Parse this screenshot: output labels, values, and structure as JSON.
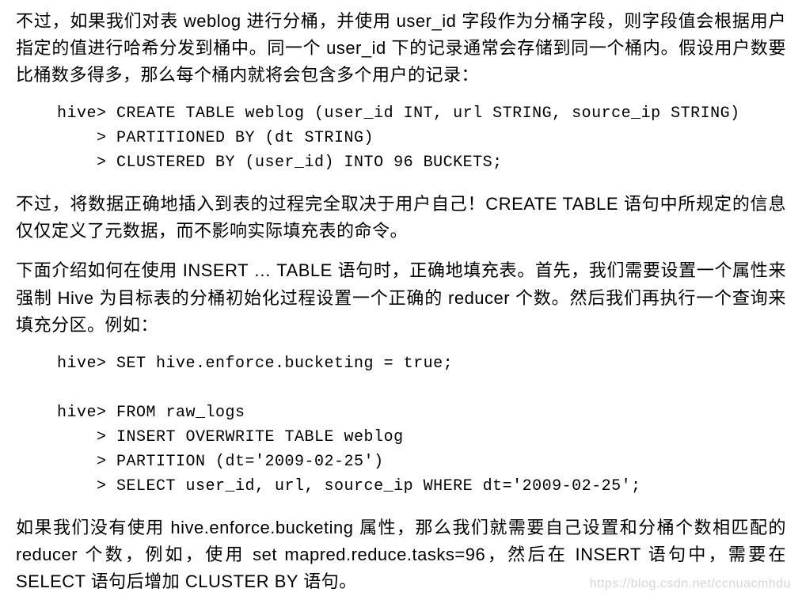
{
  "para1": "不过，如果我们对表 weblog 进行分桶，并使用 user_id 字段作为分桶字段，则字段值会根据用户指定的值进行哈希分发到桶中。同一个 user_id 下的记录通常会存储到同一个桶内。假设用户数要比桶数多得多，那么每个桶内就将会包含多个用户的记录：",
  "code1": "hive> CREATE TABLE weblog (user_id INT, url STRING, source_ip STRING)\n    > PARTITIONED BY (dt STRING)\n    > CLUSTERED BY (user_id) INTO 96 BUCKETS;",
  "para2": "不过，将数据正确地插入到表的过程完全取决于用户自己！CREATE TABLE 语句中所规定的信息仅仅定义了元数据，而不影响实际填充表的命令。",
  "para3": "下面介绍如何在使用 INSERT … TABLE 语句时，正确地填充表。首先，我们需要设置一个属性来强制 Hive 为目标表的分桶初始化过程设置一个正确的 reducer 个数。然后我们再执行一个查询来填充分区。例如：",
  "code2": "hive> SET hive.enforce.bucketing = true;\n\nhive> FROM raw_logs\n    > INSERT OVERWRITE TABLE weblog\n    > PARTITION (dt='2009-02-25')\n    > SELECT user_id, url, source_ip WHERE dt='2009-02-25';",
  "para4": "如果我们没有使用 hive.enforce.bucketing 属性，那么我们就需要自己设置和分桶个数相匹配的 reducer 个数，例如，使用 set mapred.reduce.tasks=96，然后在 INSERT 语句中，需要在 SELECT 语句后增加 CLUSTER BY 语句。",
  "watermark": "https://blog.csdn.net/ccnuacmhdu"
}
